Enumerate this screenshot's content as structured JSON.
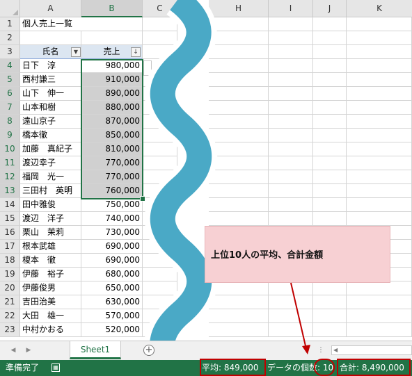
{
  "columns": {
    "A": "A",
    "B": "B",
    "C": "C",
    "H": "H",
    "I": "I",
    "J": "J",
    "K": "K"
  },
  "rows": [
    "1",
    "2",
    "3",
    "4",
    "5",
    "6",
    "7",
    "8",
    "9",
    "10",
    "11",
    "12",
    "13",
    "14",
    "15",
    "16",
    "17",
    "18",
    "19",
    "20",
    "21",
    "22",
    "23"
  ],
  "sheet_title": "個人売上一覧",
  "table_header": {
    "name": "氏名",
    "sales": "売上"
  },
  "records": [
    {
      "name": "日下　淳",
      "sales": "980,000"
    },
    {
      "name": "西村謙三",
      "sales": "910,000"
    },
    {
      "name": "山下　伸一",
      "sales": "890,000"
    },
    {
      "name": "山本和樹",
      "sales": "880,000"
    },
    {
      "name": "遠山京子",
      "sales": "870,000"
    },
    {
      "name": "橋本徹",
      "sales": "850,000"
    },
    {
      "name": "加藤　真紀子",
      "sales": "810,000"
    },
    {
      "name": "渡辺幸子",
      "sales": "770,000"
    },
    {
      "name": "福岡　光一",
      "sales": "770,000"
    },
    {
      "name": "三田村　英明",
      "sales": "760,000"
    },
    {
      "name": "田中雅俊",
      "sales": "750,000"
    },
    {
      "name": "渡辺　洋子",
      "sales": "740,000"
    },
    {
      "name": "栗山　茉莉",
      "sales": "730,000"
    },
    {
      "name": "根本武雄",
      "sales": "690,000"
    },
    {
      "name": "榎本　徹",
      "sales": "690,000"
    },
    {
      "name": "伊藤　裕子",
      "sales": "680,000"
    },
    {
      "name": "伊藤俊男",
      "sales": "650,000"
    },
    {
      "name": "吉田治美",
      "sales": "630,000"
    },
    {
      "name": "大田　雄一",
      "sales": "570,000"
    },
    {
      "name": "中村かおる",
      "sales": "520,000"
    }
  ],
  "sheet_tab": "Sheet1",
  "add_sheet": "+",
  "tab_nav": {
    "prev": "◀",
    "next": "▶",
    "more": "⋮",
    "scroll_left": "◀"
  },
  "callout": "上位10人の平均、合計金額",
  "status": {
    "ready": "準備完了",
    "average": "平均: 849,000",
    "count": "データの個数: 10",
    "sum": "合計: 8,490,000"
  },
  "colors": {
    "accent": "#217346",
    "selection_fill": "#d0d0d0",
    "callout_fill": "#f7d0d3",
    "annotation_red": "#c00000",
    "wave": "#4aa9c6"
  }
}
